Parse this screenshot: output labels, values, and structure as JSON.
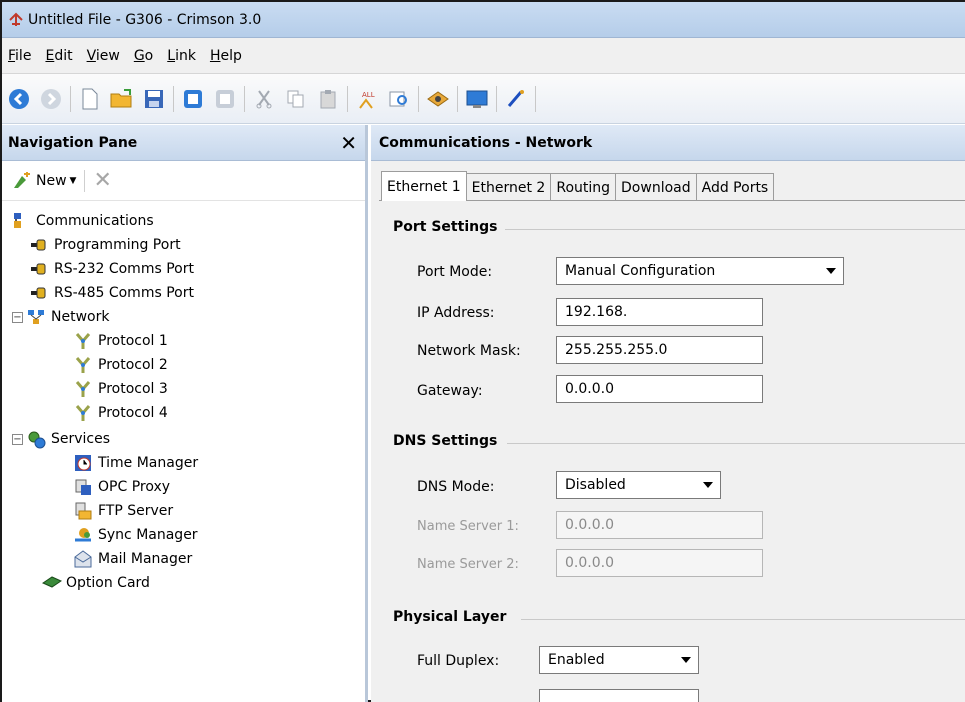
{
  "window": {
    "title": "Untitled File - G306 - Crimson 3.0"
  },
  "menu": [
    {
      "label": "File",
      "mnemonic": "F",
      "rest": "ile"
    },
    {
      "label": "Edit",
      "mnemonic": "E",
      "rest": "dit"
    },
    {
      "label": "View",
      "mnemonic": "V",
      "rest": "iew"
    },
    {
      "label": "Go",
      "mnemonic": "G",
      "rest": "o"
    },
    {
      "label": "Link",
      "mnemonic": "L",
      "rest": "ink"
    },
    {
      "label": "Help",
      "mnemonic": "H",
      "rest": "elp"
    }
  ],
  "nav": {
    "title": "Navigation Pane",
    "new_label": "New",
    "tree": [
      {
        "label": "Communications",
        "icon": "communications-icon"
      },
      {
        "label": "Programming Port",
        "icon": "port-icon"
      },
      {
        "label": "RS-232 Comms Port",
        "icon": "port-icon"
      },
      {
        "label": "RS-485 Comms Port",
        "icon": "port-icon"
      },
      {
        "label": "Network",
        "icon": "network-icon"
      },
      {
        "label": "Protocol 1",
        "icon": "protocol-icon"
      },
      {
        "label": "Protocol 2",
        "icon": "protocol-icon"
      },
      {
        "label": "Protocol 3",
        "icon": "protocol-icon"
      },
      {
        "label": "Protocol 4",
        "icon": "protocol-icon"
      },
      {
        "label": "Services",
        "icon": "services-icon"
      },
      {
        "label": "Time Manager",
        "icon": "time-manager-icon"
      },
      {
        "label": "OPC Proxy",
        "icon": "opc-proxy-icon"
      },
      {
        "label": "FTP Server",
        "icon": "ftp-server-icon"
      },
      {
        "label": "Sync Manager",
        "icon": "sync-manager-icon"
      },
      {
        "label": "Mail Manager",
        "icon": "mail-manager-icon"
      },
      {
        "label": "Option Card",
        "icon": "option-card-icon"
      }
    ]
  },
  "main": {
    "title": "Communications - Network",
    "tabs": [
      "Ethernet 1",
      "Ethernet 2",
      "Routing",
      "Download",
      "Add Ports"
    ],
    "port_settings": {
      "title": "Port Settings",
      "port_mode_label": "Port Mode:",
      "port_mode_value": "Manual Configuration",
      "ip_label": "IP Address:",
      "ip_value": "192.168.",
      "mask_label": "Network Mask:",
      "mask_value": "255.255.255.0",
      "gateway_label": "Gateway:",
      "gateway_value": "0.0.0.0"
    },
    "dns_settings": {
      "title": "DNS Settings",
      "mode_label": "DNS Mode:",
      "mode_value": "Disabled",
      "ns1_label": "Name Server 1:",
      "ns1_value": "0.0.0.0",
      "ns2_label": "Name Server 2:",
      "ns2_value": "0.0.0.0"
    },
    "physical_layer": {
      "title": "Physical Layer",
      "duplex_label": "Full Duplex:",
      "duplex_value": "Enabled"
    }
  }
}
